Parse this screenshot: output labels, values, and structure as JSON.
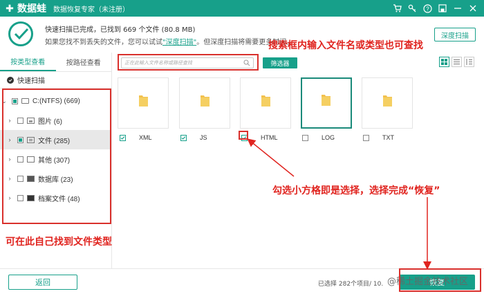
{
  "titlebar": {
    "app_name": "数据蛙",
    "subtitle": "数据恢复专家（未注册）",
    "icons": [
      "cart-icon",
      "key-icon",
      "help-icon",
      "save-icon",
      "minimize-icon",
      "close-icon"
    ],
    "bg_color": "#17a08a"
  },
  "summary": {
    "line1": "快速扫描已完成，已找到 669 个文件 (80.8 MB)",
    "line2_prefix": "如果您找不到丢失的文件，您可以试试",
    "line2_link": "\"深度扫描\"",
    "line2_suffix": "。但深度扫描将需要更多时间。",
    "deep_scan_button": "深度扫描"
  },
  "sidebar": {
    "tabs": [
      "按类型查看",
      "按路径查看"
    ],
    "active_tab": 0,
    "quick_scan": "快速扫描",
    "tree": [
      {
        "label": "C:(NTFS) (669)",
        "level": 0,
        "expanded": true
      },
      {
        "label": "图片 (6)",
        "level": 1
      },
      {
        "label": "文件 (285)",
        "level": 1,
        "selected": true
      },
      {
        "label": "其他 (307)",
        "level": 1
      },
      {
        "label": "数据库 (23)",
        "level": 1
      },
      {
        "label": "档案文件 (48)",
        "level": 1
      }
    ]
  },
  "toolbar": {
    "search_placeholder": "正在此输入文件名称或路径查找",
    "filter_button": "筛选器",
    "view_modes": [
      "grid-view-icon",
      "list-view-icon",
      "detail-view-icon"
    ]
  },
  "files": [
    {
      "name": "XML",
      "checked": true
    },
    {
      "name": "JS",
      "checked": true
    },
    {
      "name": "HTML",
      "checked": true
    },
    {
      "name": "LOG",
      "checked": false,
      "selected": true
    },
    {
      "name": "TXT",
      "checked": false
    }
  ],
  "bottom": {
    "back_button": "返回",
    "selection_info": "已选择 282个项目/ 10.",
    "recover_button": "恢复",
    "watermark": "@稀土掘金技术社区"
  },
  "annotations": {
    "search_hint": "搜索框内输入文件名或类型也可查找",
    "check_hint": "勾选小方格即是选择，选择完成“恢复”",
    "sidebar_hint": "可在此自己找到文件类型",
    "color": "#e0241f"
  }
}
